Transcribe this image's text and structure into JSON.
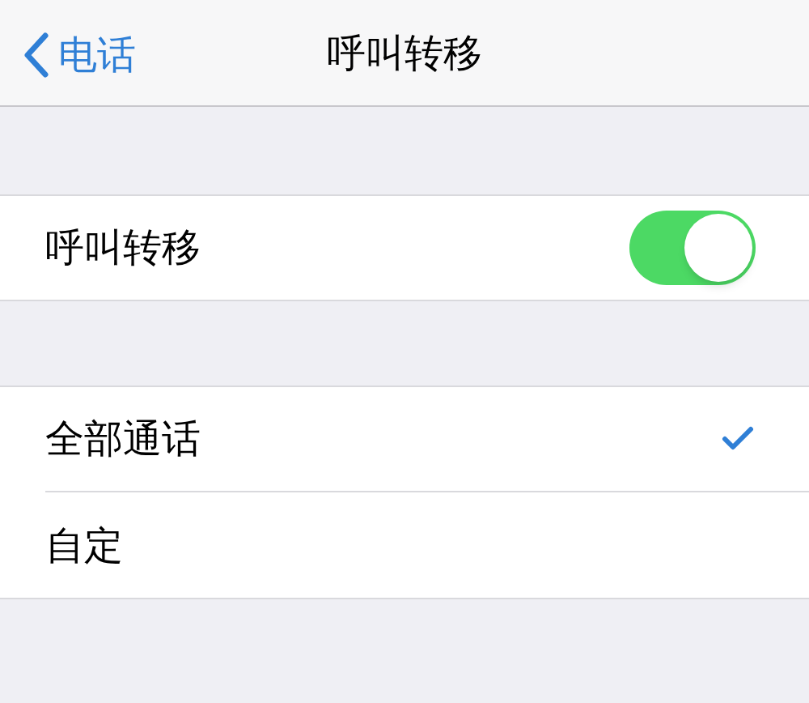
{
  "nav": {
    "back": "电话",
    "title": "呼叫转移"
  },
  "toggle_row": {
    "label": "呼叫转移",
    "on": true
  },
  "options": [
    {
      "label": "全部通话",
      "selected": true
    },
    {
      "label": "自定",
      "selected": false
    }
  ]
}
